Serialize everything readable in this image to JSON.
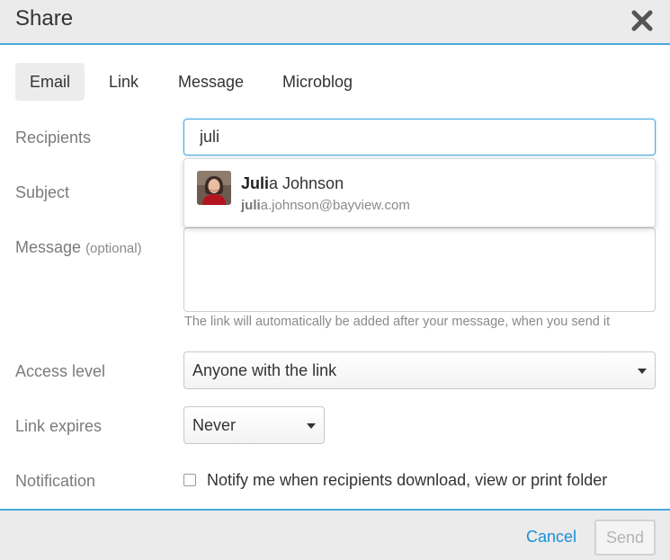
{
  "dialog": {
    "title": "Share"
  },
  "tabs": [
    {
      "label": "Email",
      "active": true
    },
    {
      "label": "Link",
      "active": false
    },
    {
      "label": "Message",
      "active": false
    },
    {
      "label": "Microblog",
      "active": false
    }
  ],
  "form": {
    "recipients_label": "Recipients",
    "recipients_value": "juli",
    "subject_label": "Subject",
    "message_label": "Message",
    "message_optional": "(optional)",
    "message_hint": "The link will automatically be added after your message, when you send it",
    "access_label": "Access level",
    "access_value": "Anyone with the link",
    "expires_label": "Link expires",
    "expires_value": "Never",
    "notification_label": "Notification",
    "notify_text": "Notify me when recipients download, view or print folder",
    "notify_checked": false
  },
  "suggestion": {
    "name_match": "Juli",
    "name_rest": "a Johnson",
    "email_match": "juli",
    "email_rest": "a.johnson@bayview.com",
    "avatar_icon": "user-photo-icon"
  },
  "footer": {
    "cancel_label": "Cancel",
    "send_label": "Send"
  },
  "colors": {
    "accent": "#48a9dc",
    "link": "#1a8fd6",
    "header_bg": "#ebebeb"
  }
}
